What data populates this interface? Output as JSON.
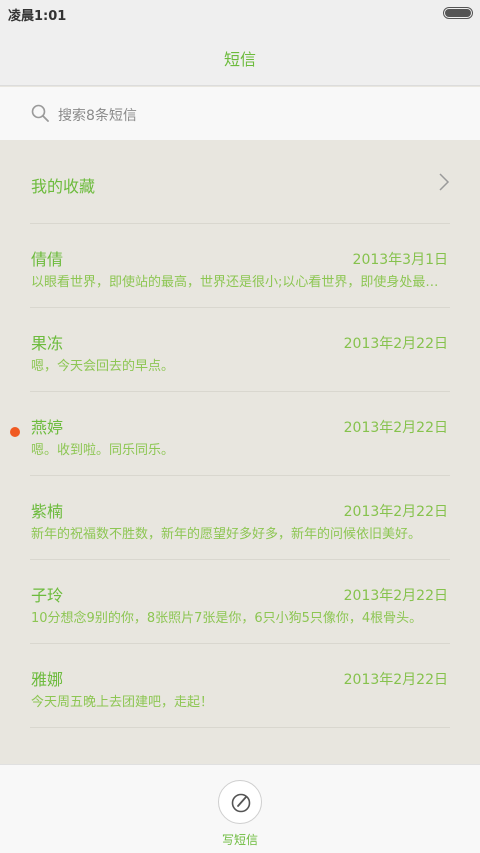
{
  "status": {
    "time": "凌晨1:01"
  },
  "header": {
    "title": "短信"
  },
  "search": {
    "placeholder": "搜索8条短信"
  },
  "favorites": {
    "label": "我的收藏"
  },
  "messages": [
    {
      "name": "倩倩",
      "date": "2013年3月1日",
      "preview": "以眼看世界，即使站的最高，世界还是很小;以心看世界，即使身处最低，世界也是很大。",
      "unread": false
    },
    {
      "name": "果冻",
      "date": "2013年2月22日",
      "preview": "嗯，今天会回去的早点。",
      "unread": false
    },
    {
      "name": "燕婷",
      "date": "2013年2月22日",
      "preview": "嗯。收到啦。同乐同乐。",
      "unread": true
    },
    {
      "name": "紫楠",
      "date": "2013年2月22日",
      "preview": "新年的祝福数不胜数，新年的愿望好多好多，新年的问候依旧美好。",
      "unread": false
    },
    {
      "name": "子玲",
      "date": "2013年2月22日",
      "preview": "10分想念9别的你，8张照片7张是你，6只小狗5只像你，4根骨头。",
      "unread": false
    },
    {
      "name": "雅娜",
      "date": "2013年2月22日",
      "preview": "今天周五晚上去团建吧，走起！",
      "unread": false
    }
  ],
  "bottom": {
    "compose_label": "写短信"
  },
  "colors": {
    "accent": "#6cbb3c",
    "unread": "#f05a22",
    "list_bg": "#e8e6df"
  }
}
